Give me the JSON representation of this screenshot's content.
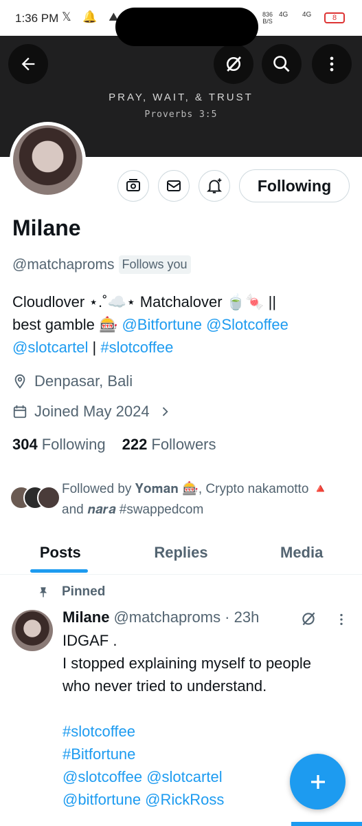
{
  "status_bar": {
    "time": "1:36 PM",
    "icons": "𝕏 🔔 ⛰",
    "net_speed": "836",
    "net_unit": "B/S",
    "signal1": "4G",
    "signal2": "4G",
    "battery": "8"
  },
  "banner": {
    "verse": "PRAY, WAIT, & TRUST",
    "reference": "Proverbs 3:5"
  },
  "profile": {
    "name": "Milane",
    "handle": "@matchaproms",
    "follows_you": "Follows you",
    "following_button": "Following",
    "bio_line1": "Cloudlover ⋆.˚☁️⋆ Matchalover 🍵🍬 ||",
    "bio_line2_text": "best gamble 🎰 ",
    "bio_mention1": "@Bitfortune",
    "bio_mention2": "@Slotcoffee",
    "bio_mention3": "@slotcartel",
    "bio_sep": " | ",
    "bio_hashtag": "#slotcoffee",
    "location": "Denpasar, Bali",
    "joined": "Joined May 2024",
    "following_count": "304",
    "following_label": "Following",
    "followers_count": "222",
    "followers_label": "Followers",
    "followed_by": "Followed by 𝐘𝐨𝐦𝐚𝐧 🎰, Crypto nakamotto 🔺 and 𝒏𝒂𝒓𝒂 #swappedcom"
  },
  "tabs": [
    {
      "label": "Posts"
    },
    {
      "label": "Replies"
    },
    {
      "label": "Media"
    }
  ],
  "pinned_tweet": {
    "pinned_label": "Pinned",
    "author_name": "Milane",
    "author_handle": "@matchaproms · 23h",
    "line1": "IDGAF .",
    "line2": "I stopped explaining myself to people who never tried to understand.",
    "hashtag1": "#slotcoffee",
    "hashtag2": "#Bitfortune",
    "mentions1": "@slotcoffee @slotcartel",
    "mentions2": "@bitfortune @RickRoss"
  },
  "colors": {
    "accent": "#1d9bf0",
    "secondary_text": "#536471",
    "banner_bg": "#1f1f20"
  }
}
